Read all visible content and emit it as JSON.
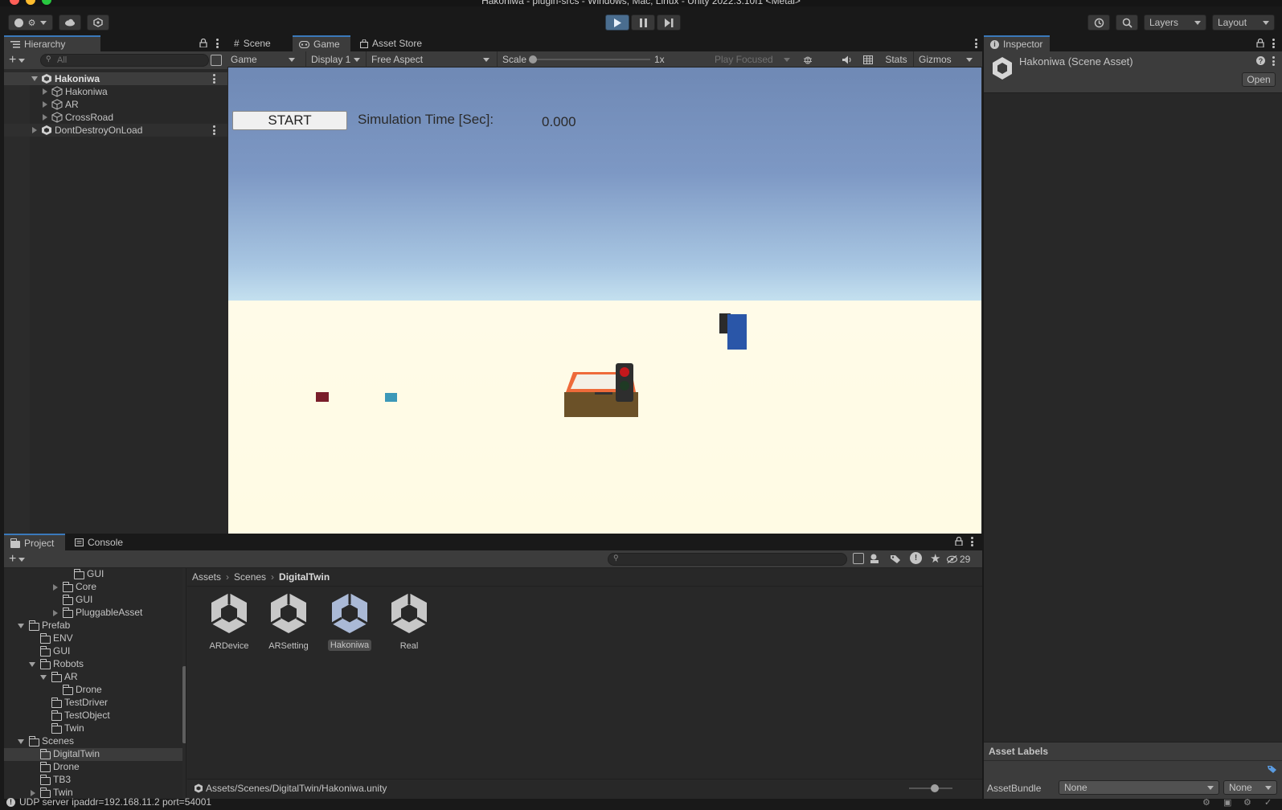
{
  "window": {
    "title": "Hakoniwa - plugin-srcs - Windows, Mac, Linux - Unity 2022.3.10f1 <Metal>"
  },
  "toolbar": {
    "layers_label": "Layers",
    "layout_label": "Layout"
  },
  "hierarchy": {
    "tab_label": "Hierarchy",
    "search_placeholder": "All",
    "items": [
      {
        "label": "Hakoniwa"
      },
      {
        "label": "Hakoniwa"
      },
      {
        "label": "AR"
      },
      {
        "label": "CrossRoad"
      },
      {
        "label": "DontDestroyOnLoad"
      }
    ]
  },
  "center_tabs": {
    "scene": "Scene",
    "game": "Game",
    "asset_store": "Asset Store"
  },
  "game_toolbar": {
    "mode": "Game",
    "display": "Display 1",
    "aspect": "Free Aspect",
    "scale_label": "Scale",
    "scale_value": "1x",
    "play_focused": "Play Focused",
    "stats": "Stats",
    "gizmos": "Gizmos"
  },
  "game_view": {
    "start_button": "START",
    "sim_time_label": "Simulation Time [Sec]:",
    "sim_time_value": "0.000"
  },
  "inspector": {
    "tab_label": "Inspector",
    "asset_title": "Hakoniwa (Scene Asset)",
    "open_button": "Open",
    "asset_labels": "Asset Labels",
    "assetbundle_label": "AssetBundle",
    "assetbundle_value": "None",
    "variant_value": "None"
  },
  "bottom_tabs": {
    "project": "Project",
    "console": "Console"
  },
  "project_tree": [
    {
      "label": "GUI"
    },
    {
      "label": "Core"
    },
    {
      "label": "GUI"
    },
    {
      "label": "PluggableAsset"
    },
    {
      "label": "Prefab"
    },
    {
      "label": "ENV"
    },
    {
      "label": "GUI"
    },
    {
      "label": "Robots"
    },
    {
      "label": "AR"
    },
    {
      "label": "Drone"
    },
    {
      "label": "TestDriver"
    },
    {
      "label": "TestObject"
    },
    {
      "label": "Twin"
    },
    {
      "label": "Scenes"
    },
    {
      "label": "DigitalTwin"
    },
    {
      "label": "Drone"
    },
    {
      "label": "TB3"
    },
    {
      "label": "Twin"
    }
  ],
  "breadcrumb": {
    "assets": "Assets",
    "scenes": "Scenes",
    "current": "DigitalTwin"
  },
  "hidden_count": "29",
  "assets": [
    {
      "label": "ARDevice"
    },
    {
      "label": "ARSetting"
    },
    {
      "label": "Hakoniwa"
    },
    {
      "label": "Real"
    }
  ],
  "asset_path": "Assets/Scenes/DigitalTwin/Hakoniwa.unity",
  "status_bar": {
    "message": "UDP server ipaddr=192.168.11.2 port=54001"
  },
  "colors": {
    "accent": "#3a79bb",
    "selection": "#2c5d87",
    "sky_top": "#6f88b4",
    "ground": "#fffbea"
  }
}
